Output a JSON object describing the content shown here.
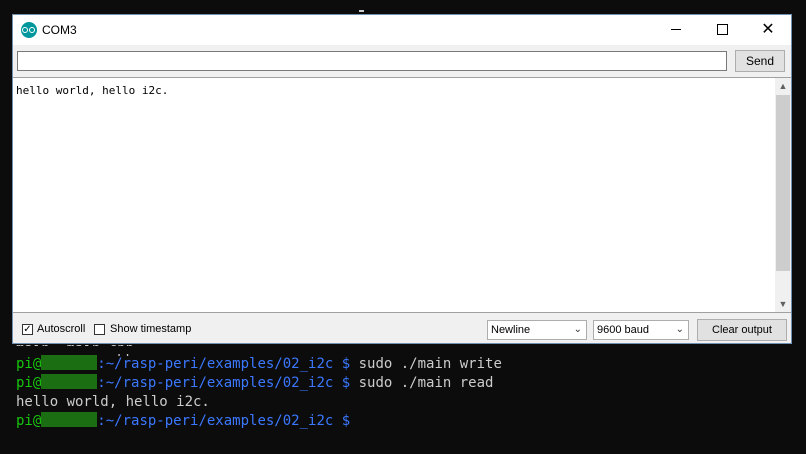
{
  "window": {
    "title": "COM3",
    "send_placeholder": "",
    "send_label": "Send",
    "output": "hello world, hello i2c.",
    "autoscroll_label": "Autoscroll",
    "autoscroll_checked": true,
    "timestamp_label": "Show timestamp",
    "timestamp_checked": false,
    "line_ending": "Newline",
    "baud": "9600 baud",
    "clear_label": "Clear output"
  },
  "terminal": {
    "partial_line": "main  main.cpp",
    "user": "pi@",
    "path": ":~/rasp-peri/examples/02_i2c $",
    "lines": [
      {
        "cmd": " sudo ./main write"
      },
      {
        "cmd": " sudo ./main read"
      },
      {
        "out": "hello world, hello i2c."
      },
      {
        "cmd": ""
      }
    ]
  }
}
